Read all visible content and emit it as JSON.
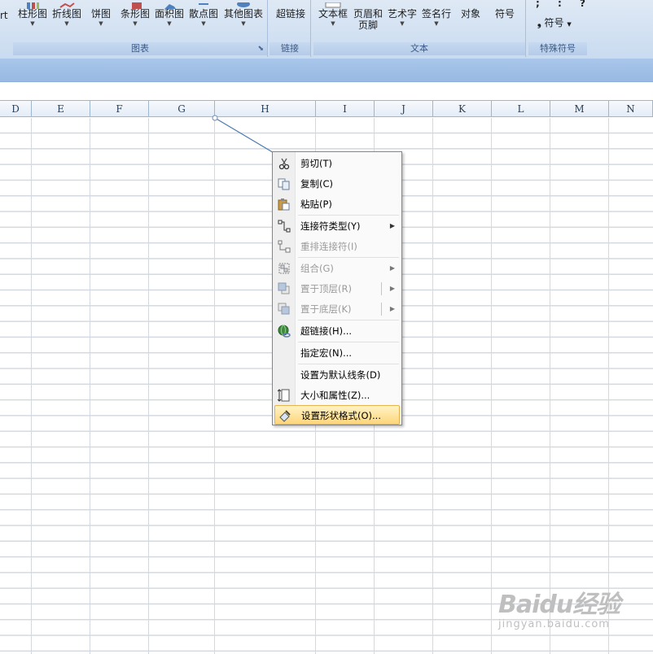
{
  "ribbon": {
    "charts_group": {
      "label": "图表",
      "partial": "rt",
      "buttons": [
        "柱形图",
        "折线图",
        "饼图",
        "条形图",
        "面积图",
        "散点图",
        "其他图表"
      ]
    },
    "links_group": {
      "label": "链接",
      "button": "超链接"
    },
    "text_group": {
      "label": "文本",
      "buttons": [
        {
          "line1": "文本框",
          "line2": ""
        },
        {
          "line1": "页眉和",
          "line2": "页脚"
        },
        {
          "line1": "艺术字",
          "line2": ""
        },
        {
          "line1": "签名行",
          "line2": ""
        },
        {
          "line1": "对象",
          "line2": ""
        },
        {
          "line1": "符号",
          "line2": ""
        }
      ]
    },
    "symbols_group": {
      "label": "特殊符号",
      "marks": "; : ?",
      "button": "符号"
    }
  },
  "columns": [
    "D",
    "E",
    "F",
    "G",
    "H",
    "I",
    "J",
    "K",
    "L",
    "M",
    "N"
  ],
  "context_menu": {
    "items": [
      {
        "label": "剪切(T)",
        "icon": "scissors-icon",
        "enabled": true,
        "submenu": false
      },
      {
        "label": "复制(C)",
        "icon": "copy-icon",
        "enabled": true,
        "submenu": false
      },
      {
        "label": "粘贴(P)",
        "icon": "paste-icon",
        "enabled": true,
        "submenu": false
      },
      {
        "label": "连接符类型(Y)",
        "icon": "connector-type-icon",
        "enabled": true,
        "submenu": true
      },
      {
        "label": "重排连接符(I)",
        "icon": "reroute-connector-icon",
        "enabled": false,
        "submenu": false
      },
      {
        "label": "组合(G)",
        "icon": "group-icon",
        "enabled": false,
        "submenu": true
      },
      {
        "label": "置于顶层(R)",
        "icon": "bring-to-front-icon",
        "enabled": false,
        "submenu": true
      },
      {
        "label": "置于底层(K)",
        "icon": "send-to-back-icon",
        "enabled": false,
        "submenu": true
      },
      {
        "label": "超链接(H)...",
        "icon": "hyperlink-globe-icon",
        "enabled": true,
        "submenu": false
      },
      {
        "label": "指定宏(N)...",
        "icon": "",
        "enabled": true,
        "submenu": false
      },
      {
        "label": "设置为默认线条(D)",
        "icon": "",
        "enabled": true,
        "submenu": false
      },
      {
        "label": "大小和属性(Z)...",
        "icon": "size-properties-icon",
        "enabled": true,
        "submenu": false
      },
      {
        "label": "设置形状格式(O)...",
        "icon": "format-shape-icon",
        "enabled": true,
        "submenu": false,
        "highlighted": true
      }
    ]
  },
  "watermark": {
    "brand": "Baidu经验",
    "url": "jingyan.baidu.com"
  },
  "colors": {
    "menu_highlight": "#fed67a",
    "ribbon_bg": "#c9dbf0",
    "connector_line": "#4a7ab0"
  }
}
